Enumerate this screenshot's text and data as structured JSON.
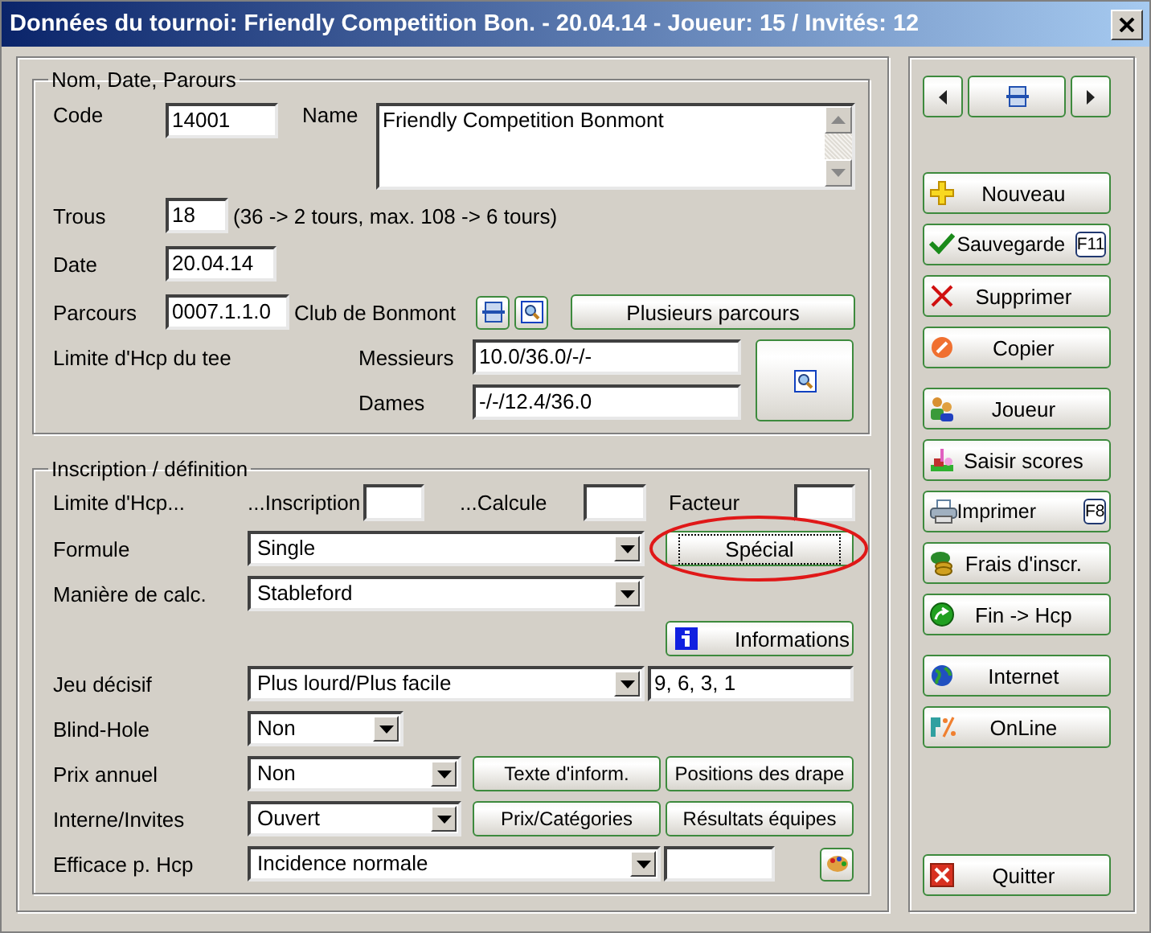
{
  "window": {
    "title": "Données du tournoi: Friendly Competition Bon. - 20.04.14 - Joueur: 15 / Invités: 12"
  },
  "general": {
    "title": "Nom, Date, Parours",
    "code": {
      "label": "Code",
      "value": "14001"
    },
    "name": {
      "label": "Name",
      "value": "Friendly Competition Bonmont"
    },
    "holes": {
      "label": "Trous",
      "value": "18",
      "hint": "(36 -> 2 tours, max. 108 -> 6 tours)"
    },
    "date": {
      "label": "Date",
      "value": "20.04.14"
    },
    "course": {
      "label": "Parcours",
      "value": "0007.1.1.0",
      "club": "Club de Bonmont",
      "button": "Plusieurs parcours"
    },
    "tee_limit": {
      "label": "Limite d'Hcp du tee",
      "men": {
        "label": "Messieurs",
        "value": "10.0/36.0/-/-"
      },
      "women": {
        "label": "Dames",
        "value": "-/-/12.4/36.0"
      }
    }
  },
  "registration": {
    "title": "Inscription / définition",
    "hcp_limit": {
      "label": "Limite d'Hcp...",
      "inscription": "...Inscription",
      "calcule": "...Calcule",
      "facteur": "Facteur"
    },
    "formula": {
      "label": "Formule",
      "value": "Single"
    },
    "special": {
      "label": "Spécial",
      "focused": true,
      "highlighted": true
    },
    "calc": {
      "label": "Manière de calc.",
      "value": "Stableford"
    },
    "informations": "Informations",
    "tiebreak": {
      "label": "Jeu décisif",
      "value": "Plus lourd/Plus facile",
      "holes": "9, 6, 3, 1"
    },
    "blind_hole": {
      "label": "Blind-Hole",
      "value": "Non"
    },
    "annual": {
      "label": "Prix annuel",
      "value": "Non",
      "buttons": [
        "Texte d'inform.",
        "Positions des drape"
      ]
    },
    "members": {
      "label": "Interne/Invites",
      "value": "Ouvert",
      "buttons": [
        "Prix/Catégories",
        "Résultats équipes"
      ]
    },
    "hcp_effect": {
      "label": "Efficace p. Hcp",
      "value": "Incidence normale"
    }
  },
  "action_groups": [
    {
      "buttons": [
        {
          "label": "Nouveau",
          "kind": "plus"
        },
        {
          "label": "Sauvegarde",
          "kind": "check",
          "shortcut": "F11"
        },
        {
          "label": "Supprimer",
          "kind": "cross"
        },
        {
          "label": "Copier",
          "kind": "copy"
        }
      ]
    },
    {
      "buttons": [
        {
          "label": "Joueur",
          "kind": "players"
        },
        {
          "label": "Saisir scores",
          "kind": "scores"
        },
        {
          "label": "Imprimer",
          "kind": "printer",
          "shortcut": "F8"
        },
        {
          "label": "Frais d'inscr.",
          "kind": "coins"
        },
        {
          "label": "Fin -> Hcp",
          "kind": "arrow"
        }
      ]
    },
    {
      "buttons": [
        {
          "label": "Internet",
          "kind": "globe"
        },
        {
          "label": "OnLine",
          "kind": "online"
        }
      ]
    }
  ],
  "quit": {
    "label": "Quitter",
    "kind": "quit"
  }
}
